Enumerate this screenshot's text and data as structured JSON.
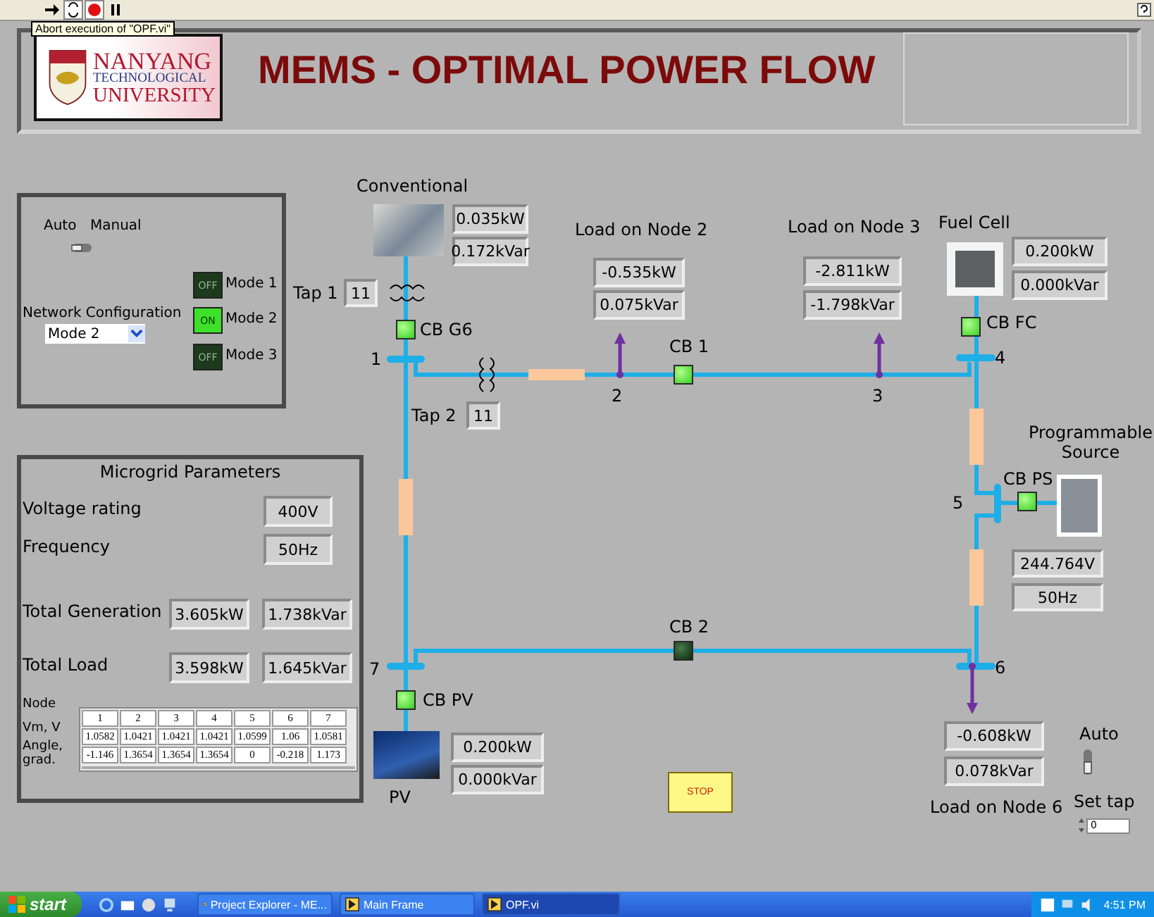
{
  "toolbar": {
    "tooltip": "Abort execution of \"OPF.vi\""
  },
  "header": {
    "logo": [
      "NANYANG",
      "TECHNOLOGICAL",
      "UNIVERSITY"
    ],
    "title": "MEMS - OPTIMAL POWER FLOW"
  },
  "control_panel": {
    "switch_labels": [
      "Auto",
      "Manual"
    ],
    "switch": {
      "on": false
    },
    "network_configuration": {
      "label": "Network Configuration",
      "value": "Mode 2"
    },
    "modes": [
      {
        "label": "Mode 1",
        "led_text": "OFF",
        "on": false
      },
      {
        "label": "Mode 2",
        "led_text": "ON",
        "on": true
      },
      {
        "label": "Mode 3",
        "led_text": "OFF",
        "on": false
      }
    ]
  },
  "microgrid": {
    "title": "Microgrid Parameters",
    "rows": [
      {
        "label": "Voltage rating",
        "values": [
          "400V"
        ]
      },
      {
        "label": "Frequency",
        "values": [
          "50Hz"
        ]
      },
      {
        "label": "Total Generation",
        "values": [
          "3.605kW",
          "1.738kVar"
        ]
      },
      {
        "label": "Total Load",
        "values": [
          "3.598kW",
          "1.645kVar"
        ]
      }
    ],
    "table": {
      "row_labels": [
        "Node",
        "Vm, V",
        "Angle, grad."
      ],
      "columns": [
        "1",
        "2",
        "3",
        "4",
        "5",
        "6",
        "7"
      ],
      "rows": [
        [
          "1.0582",
          "1.0421",
          "1.0421",
          "1.0421",
          "1.0599",
          "1.06",
          "1.0581"
        ],
        [
          "-1.146",
          "1.3654",
          "1.3654",
          "1.3654",
          "0",
          "-0.218",
          "1.173"
        ]
      ]
    }
  },
  "generators": [
    {
      "name": "Conventional",
      "p": "0.035kW",
      "q": "0.172kVar"
    },
    {
      "name": "Fuel Cell",
      "p": "0.200kW",
      "q": "0.000kVar"
    },
    {
      "name": "PV",
      "p": "0.200kW",
      "q": "0.000kVar"
    }
  ],
  "programmable_source": {
    "name": "Programmable Source",
    "voltage": "244.764V",
    "frequency": "50Hz"
  },
  "loads": [
    {
      "name": "Load on Node 2",
      "p": "-0.535kW",
      "q": "0.075kVar"
    },
    {
      "name": "Load on Node 3",
      "p": "-2.811kW",
      "q": "-1.798kVar"
    },
    {
      "name": "Load on Node 6",
      "p": "-0.608kW",
      "q": "0.078kVar"
    }
  ],
  "breakers": [
    {
      "label": "CB G6",
      "on": true
    },
    {
      "label": "CB 1",
      "on": true
    },
    {
      "label": "CB FC",
      "on": true
    },
    {
      "label": "CB PS",
      "on": true
    },
    {
      "label": "CB 2",
      "on": false
    },
    {
      "label": "CB PV",
      "on": true
    }
  ],
  "nodes": [
    "1",
    "2",
    "3",
    "4",
    "5",
    "6",
    "7"
  ],
  "taps": [
    {
      "label": "Tap 1",
      "value": "11"
    },
    {
      "label": "Tap 2",
      "value": "11"
    }
  ],
  "stop_button": "STOP",
  "tap_control": {
    "switch_label": "Auto",
    "switch": {
      "on": false
    },
    "label": "Set tap",
    "value": "0"
  },
  "taskbar": {
    "start": "start",
    "tasks": [
      {
        "label": "Project Explorer - ME...",
        "selected": false
      },
      {
        "label": "Main Frame",
        "selected": false
      },
      {
        "label": "OPF.vi",
        "selected": true
      }
    ],
    "clock": "4:51 PM"
  }
}
